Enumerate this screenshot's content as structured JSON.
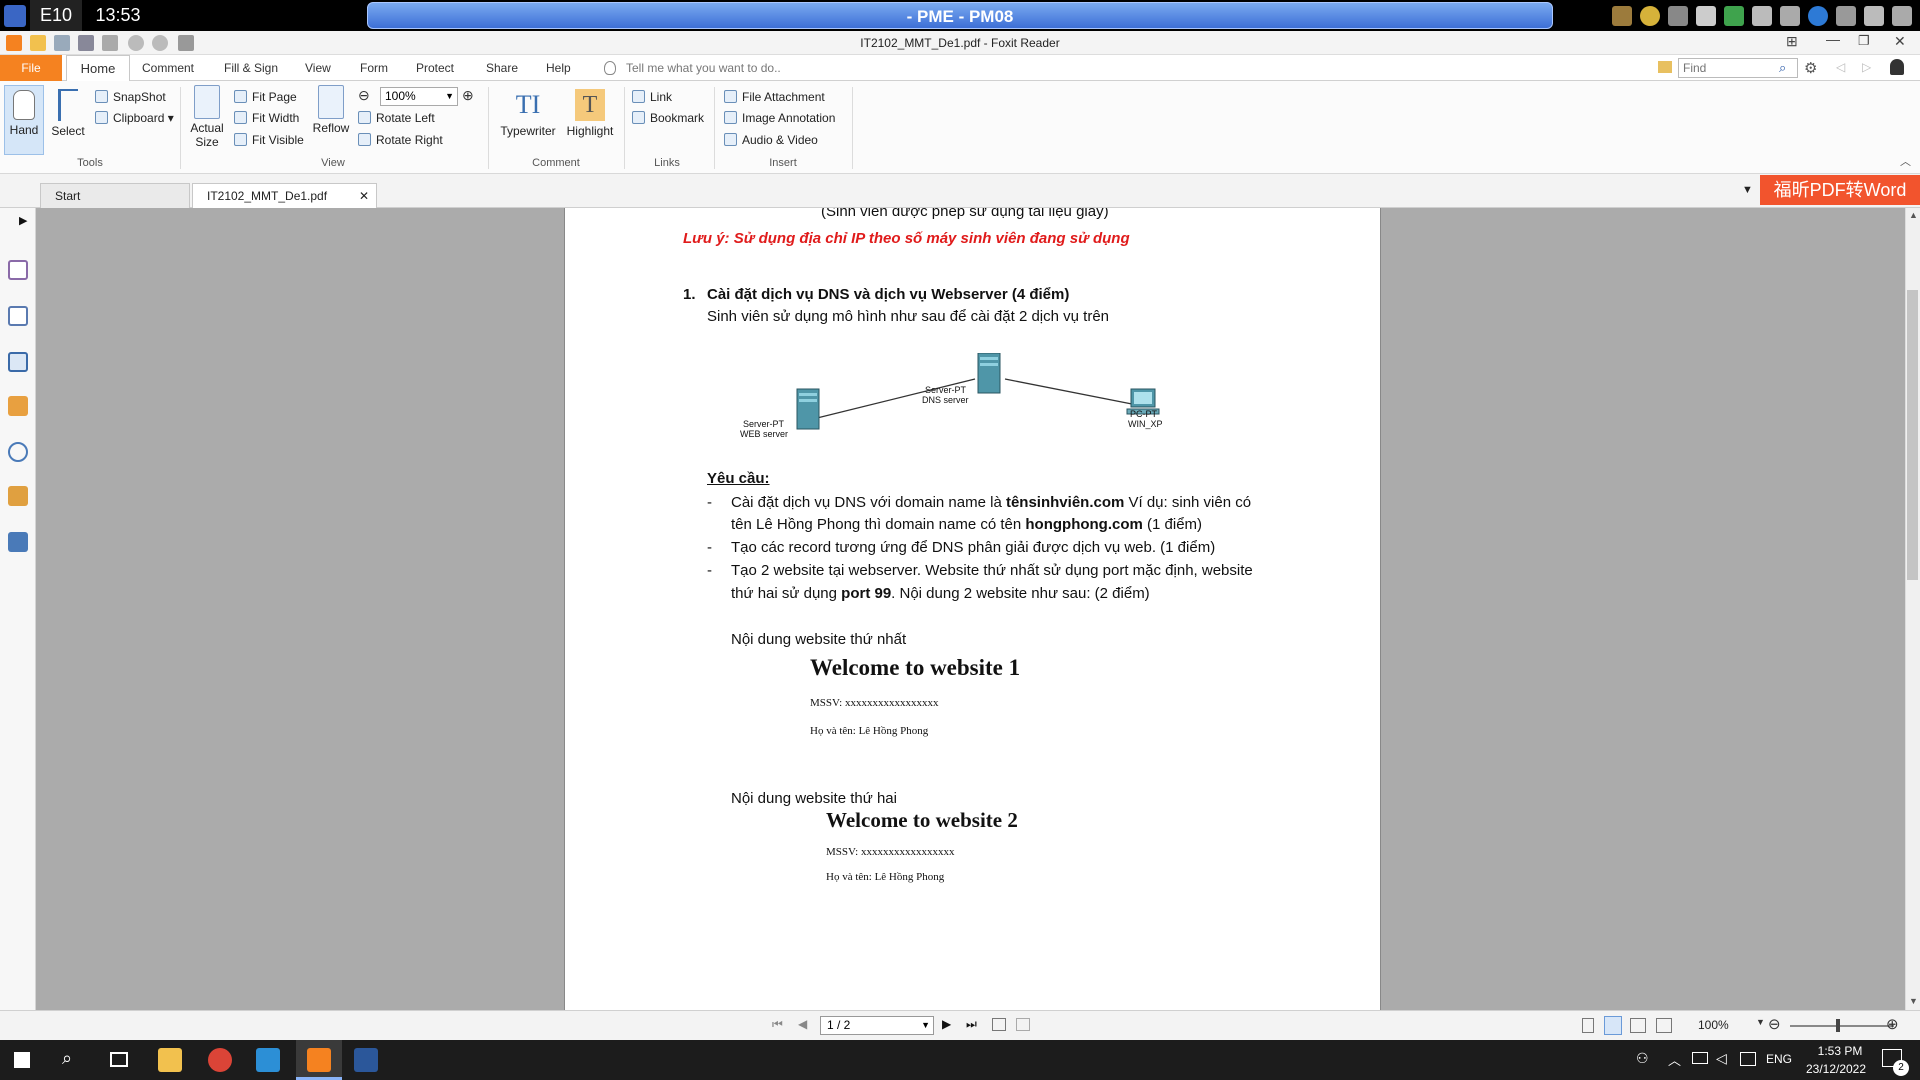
{
  "system_bar": {
    "left_label": "E10",
    "clock": "13:53",
    "center_title": "- PME - PM08"
  },
  "window": {
    "title": "IT2102_MMT_De1.pdf - Foxit Reader"
  },
  "menu": {
    "tabs": [
      "File",
      "Home",
      "Comment",
      "Fill & Sign",
      "View",
      "Form",
      "Protect",
      "Share",
      "Help"
    ],
    "tell_me": "Tell me what you want to do..",
    "find_placeholder": "Find"
  },
  "ribbon": {
    "tools": {
      "hand": "Hand",
      "select": "Select",
      "snapshot": "SnapShot",
      "clipboard": "Clipboard",
      "group": "Tools"
    },
    "view": {
      "actual_size_1": "Actual",
      "actual_size_2": "Size",
      "fit_page": "Fit Page",
      "fit_width": "Fit Width",
      "fit_visible": "Fit Visible",
      "reflow": "Reflow",
      "zoom": "100%",
      "rotate_left": "Rotate Left",
      "rotate_right": "Rotate Right",
      "group": "View"
    },
    "comment": {
      "typewriter": "Typewriter",
      "highlight": "Highlight",
      "group": "Comment"
    },
    "links": {
      "link": "Link",
      "bookmark": "Bookmark",
      "group": "Links"
    },
    "insert": {
      "file_attachment": "File Attachment",
      "image_annotation": "Image Annotation",
      "audio_video": "Audio & Video",
      "group": "Insert"
    }
  },
  "doc_tabs": {
    "start": "Start",
    "active": "IT2102_MMT_De1.pdf",
    "promo": "福昕PDF转Word"
  },
  "document": {
    "top_partial": "(Sinh viên được phép sử dụng tài liệu giấy)",
    "note": "Lưu ý: Sử dụng địa chỉ IP theo số máy sinh viên đang sử dụng",
    "q1_number": "1.",
    "q1_title": "Cài đặt dịch vụ DNS và dịch vụ Webserver (4 điểm)",
    "q1_desc": "Sinh viên sử dụng mô hình như sau để cài đặt 2 dịch vụ trên",
    "diagram": {
      "web_l1": "Server-PT",
      "web_l2": "WEB server",
      "dns_l1": "Server-PT",
      "dns_l2": "DNS server",
      "pc_l1": "PC-PT",
      "pc_l2": "WIN_XP"
    },
    "req_title": "Yêu cầu:",
    "req1_a": "Cài đặt dịch vụ DNS với domain name là ",
    "req1_b": "tênsinhviên.com",
    "req1_c": " Ví dụ: sinh viên có",
    "req1_d": "tên Lê Hồng Phong thì domain name có tên ",
    "req1_e": "hongphong.com",
    "req1_f": " (1 điểm)",
    "req2": "Tạo các record tương ứng để DNS phân giải được dịch vụ web. (1 điểm)",
    "req3_a": "Tạo 2 website tại webserver. Website thứ nhất sử dụng port mặc định, website",
    "req3_b": "thứ hai sử dụng ",
    "req3_c": "port 99",
    "req3_d": ". Nội dung 2 website như sau: (2 điểm)",
    "site1_label": "Nội dung website thứ nhất",
    "site1_title": "Welcome to website 1",
    "site1_mssv": "MSSV: xxxxxxxxxxxxxxxxx",
    "site1_name": "Họ và tên: Lê Hồng Phong",
    "site2_label": "Nội dung website thứ hai",
    "site2_title": "Welcome to website 2",
    "site2_mssv": "MSSV: xxxxxxxxxxxxxxxxx",
    "site2_name": "Họ và tên: Lê Hồng Phong"
  },
  "status": {
    "page": "1 / 2",
    "zoom": "100%"
  },
  "taskbar": {
    "lang": "ENG",
    "time": "1:53 PM",
    "date": "23/12/2022",
    "notif_count": "2"
  }
}
